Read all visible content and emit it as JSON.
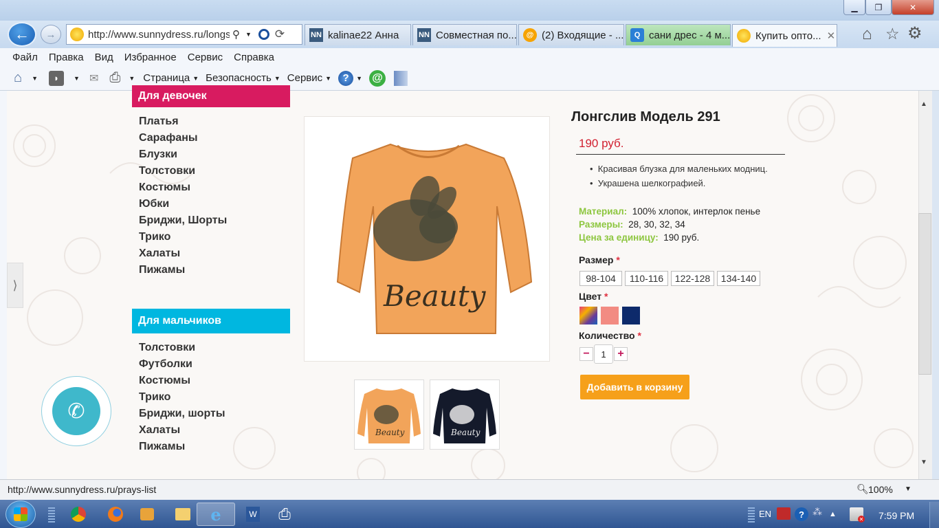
{
  "browser": {
    "address_url": "http://www.sunnydress.ru/longs",
    "tabs": [
      {
        "label": "kalinae22 Анна",
        "icon": "nn-icon"
      },
      {
        "label": "Совместная по...",
        "icon": "nn-icon"
      },
      {
        "label": "(2) Входящие - ...",
        "icon": "mail-icon"
      },
      {
        "label": "сани дрес - 4 м...",
        "icon": "search-icon"
      },
      {
        "label": "Купить опто...",
        "icon": "sun-icon",
        "active": true
      }
    ],
    "menu": [
      "Файл",
      "Правка",
      "Вид",
      "Избранное",
      "Сервис",
      "Справка"
    ],
    "commands": [
      "Страница",
      "Безопасность",
      "Сервис"
    ],
    "status_url": "http://www.sunnydress.ru/prays-list",
    "zoom": "100%"
  },
  "sidebar": {
    "girls_title": "Для девочек",
    "girls_color": "#d81b60",
    "girls_items": [
      "Платья",
      "Сарафаны",
      "Блузки",
      "Толстовки",
      "Костюмы",
      "Юбки",
      "Бриджи, Шорты",
      "Трико",
      "Халаты",
      "Пижамы"
    ],
    "boys_title": "Для мальчиков",
    "boys_color": "#00b7e0",
    "boys_items": [
      "Толстовки",
      "Футболки",
      "Костюмы",
      "Трико",
      "Бриджи, шорты",
      "Халаты",
      "Пижамы"
    ]
  },
  "product": {
    "title": "Лонгслив Модель 291",
    "price": "190 руб.",
    "bullets": [
      "Красивая блузка для маленьких модниц.",
      "Украшена шелкографией."
    ],
    "material_label": "Материал:",
    "material_value": "100% хлопок, интерлок пенье",
    "sizes_label": "Размеры:",
    "sizes_value": "28, 30, 32, 34",
    "unit_price_label": "Цена за единицу:",
    "unit_price_value": "190 руб.",
    "size_label": "Размер",
    "size_options": [
      "98-104",
      "110-116",
      "122-128",
      "134-140"
    ],
    "color_label": "Цвет",
    "color_swatches": [
      "#6a3a9a",
      "#f28b82",
      "#0d2a6b"
    ],
    "qty_label": "Количество",
    "qty_value": "1",
    "qty_minus": "−",
    "qty_plus": "+",
    "required_mark": "*",
    "add_to_cart": "Добавить в корзину",
    "print_text": "Beauty"
  },
  "taskbar": {
    "lang": "EN",
    "time": "7:59 PM"
  }
}
